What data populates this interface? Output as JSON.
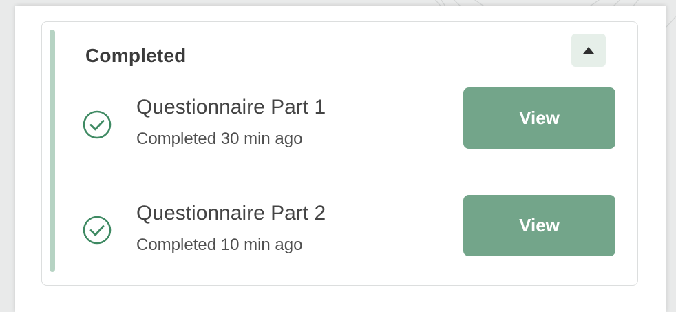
{
  "section": {
    "title": "Completed",
    "toggle_icon": "caret-up-icon",
    "accent_color": "#b6d3c3",
    "items": [
      {
        "title": "Questionnaire Part 1",
        "status": "Completed 30 min ago",
        "action_label": "View",
        "icon": "check-circle-icon"
      },
      {
        "title": "Questionnaire Part 2",
        "status": "Completed 10 min ago",
        "action_label": "View",
        "icon": "check-circle-icon"
      }
    ]
  },
  "colors": {
    "button": "#73a58a",
    "check": "#3f8a63",
    "toggle_bg": "#e6efe9"
  }
}
